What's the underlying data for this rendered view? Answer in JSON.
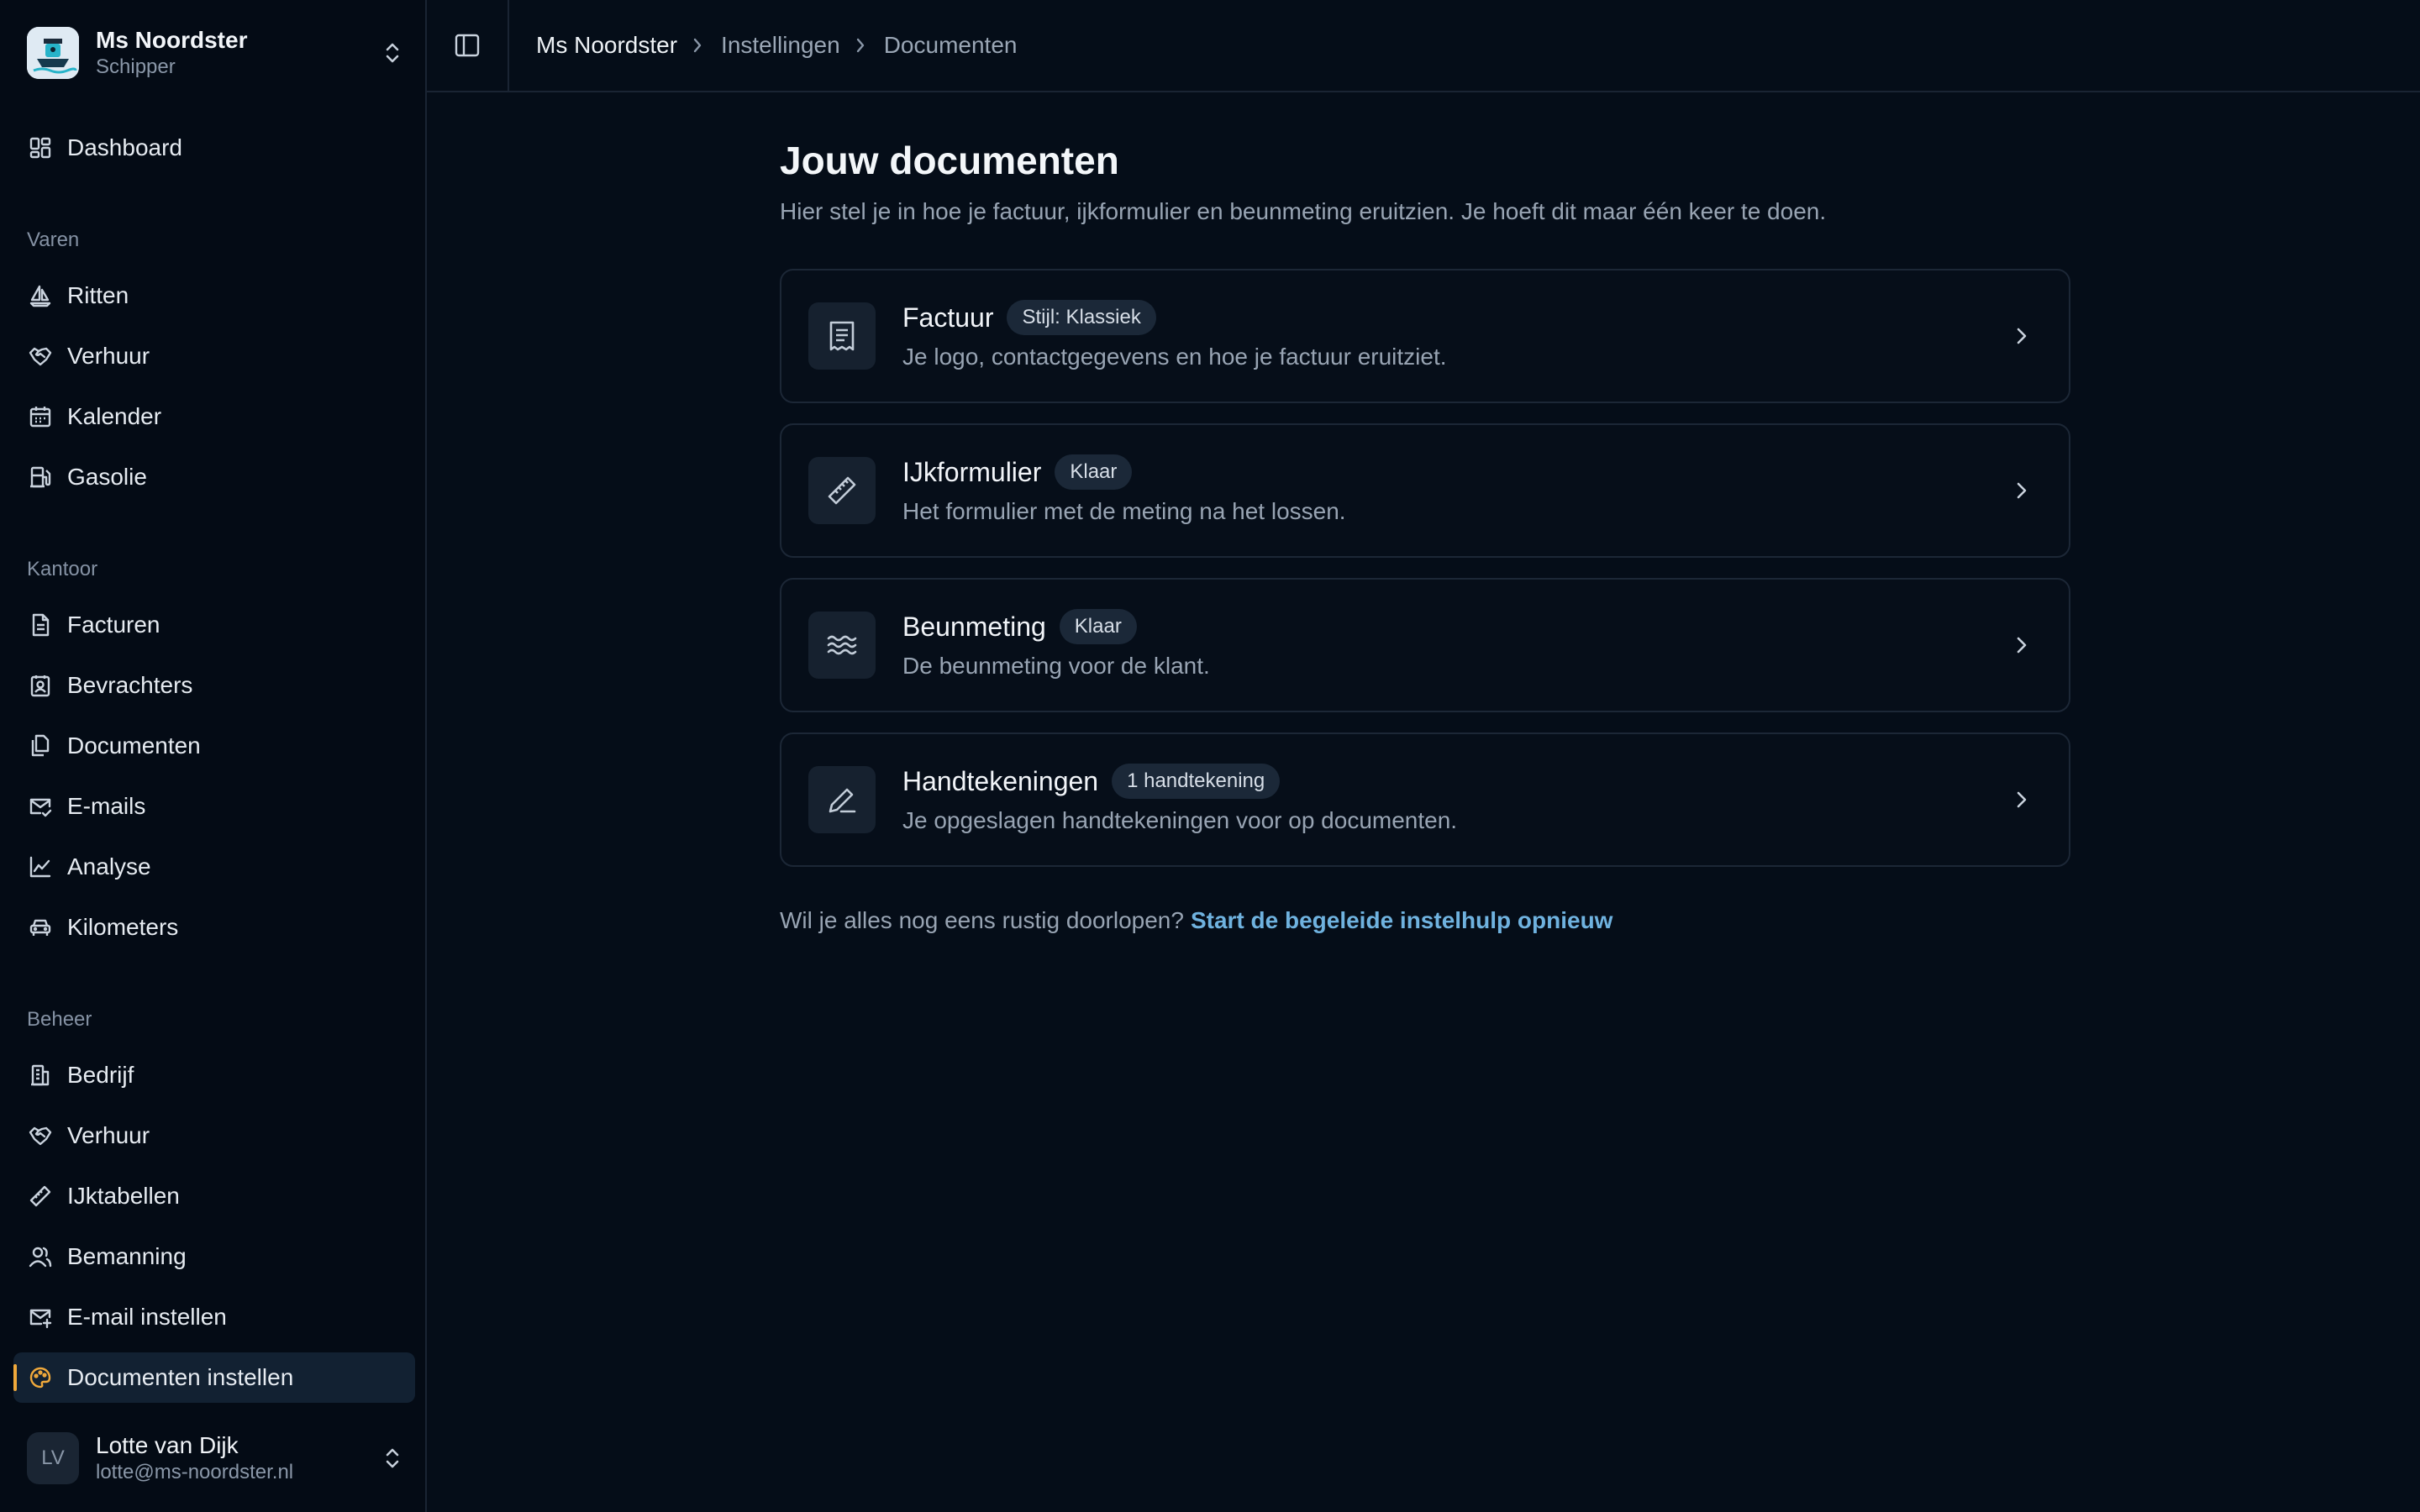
{
  "workspace": {
    "name": "Ms Noordster",
    "role": "Schipper"
  },
  "nav": {
    "dashboard": "Dashboard",
    "sections": [
      {
        "label": "Varen",
        "items": [
          "Ritten",
          "Verhuur",
          "Kalender",
          "Gasolie"
        ]
      },
      {
        "label": "Kantoor",
        "items": [
          "Facturen",
          "Bevrachters",
          "Documenten",
          "E-mails",
          "Analyse",
          "Kilometers"
        ]
      },
      {
        "label": "Beheer",
        "items": [
          "Bedrijf",
          "Verhuur",
          "IJktabellen",
          "Bemanning",
          "E-mail instellen",
          "Documenten instellen"
        ]
      }
    ],
    "active": "Documenten instellen"
  },
  "user": {
    "initials": "LV",
    "name": "Lotte van Dijk",
    "email": "lotte@ms-noordster.nl"
  },
  "breadcrumb": [
    "Ms Noordster",
    "Instellingen",
    "Documenten"
  ],
  "page": {
    "title": "Jouw documenten",
    "subtitle": "Hier stel je in hoe je factuur, ijkformulier en beunmeting eruitzien. Je hoeft dit maar één keer te doen."
  },
  "cards": [
    {
      "title": "Factuur",
      "badge": "Stijl: Klassiek",
      "desc": "Je logo, contactgegevens en hoe je factuur eruitziet.",
      "icon": "receipt-icon"
    },
    {
      "title": "IJkformulier",
      "badge": "Klaar",
      "desc": "Het formulier met de meting na het lossen.",
      "icon": "ruler-icon"
    },
    {
      "title": "Beunmeting",
      "badge": "Klaar",
      "desc": "De beunmeting voor de klant.",
      "icon": "waves-icon"
    },
    {
      "title": "Handtekeningen",
      "badge": "1 handtekening",
      "desc": "Je opgeslagen handtekeningen voor op documenten.",
      "icon": "pen-icon"
    }
  ],
  "help": {
    "text": "Wil je alles nog eens rustig doorlopen?",
    "link": "Start de begeleide instelhulp opnieuw"
  },
  "colors": {
    "background": "#050d18",
    "accent": "#f0a93b",
    "link": "#6fb2df"
  }
}
